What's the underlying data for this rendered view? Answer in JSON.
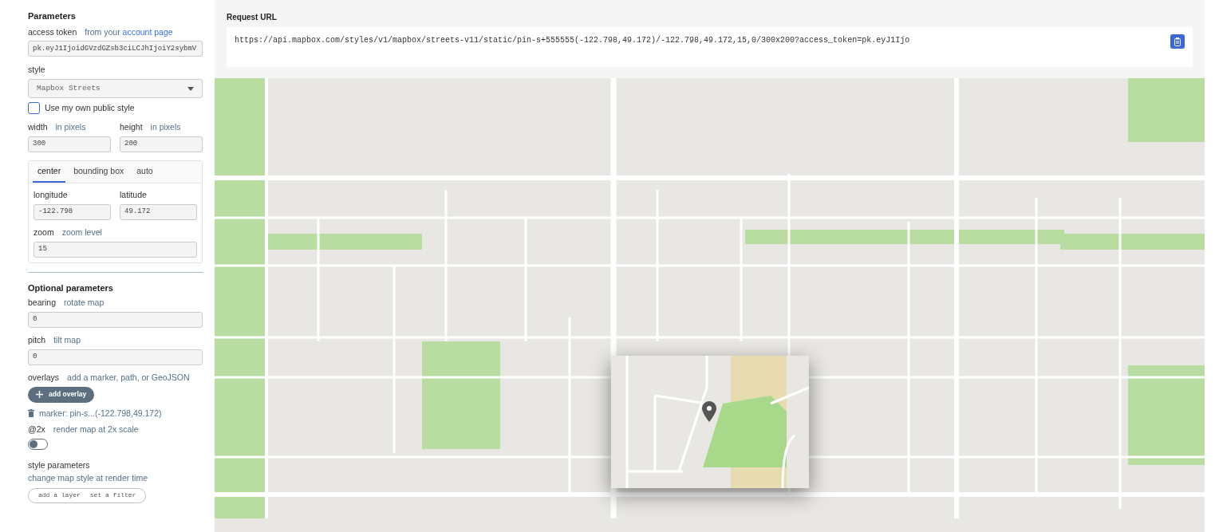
{
  "parameters": {
    "title": "Parameters",
    "access_token": {
      "label": "access token",
      "hint": "from your",
      "link": "account page",
      "value": "pk.eyJ1IjoidGVzdGZsb3ciLCJhIjoiY2sybmV"
    },
    "style": {
      "label": "style",
      "value": "Mapbox Streets"
    },
    "own_style": {
      "label": "Use my own public style",
      "checked": false
    },
    "size": [
      {
        "label": "width",
        "hint": "in pixels",
        "value": "300"
      },
      {
        "label": "height",
        "hint": "in pixels",
        "value": "200"
      }
    ],
    "tabs": [
      {
        "label": "center",
        "selected": true
      },
      {
        "label": "bounding box",
        "selected": false
      },
      {
        "label": "auto",
        "selected": false
      }
    ],
    "center": [
      {
        "label": "longitude",
        "value": "-122.798"
      },
      {
        "label": "latitude",
        "value": "49.172"
      }
    ],
    "zoom": {
      "label": "zoom",
      "hint": "zoom level",
      "value": "15"
    }
  },
  "optional": {
    "title": "Optional parameters",
    "fields": [
      {
        "label": "bearing",
        "hint": "rotate map",
        "value": "0"
      },
      {
        "label": "pitch",
        "hint": "tilt map",
        "value": "0"
      }
    ],
    "overlays": {
      "label": "overlays",
      "hint": "add a marker, path, or GeoJSON",
      "button": "add overlay",
      "items": [
        "marker: pin-s...(-122.798,49.172)"
      ]
    },
    "retina": {
      "label": "@2x",
      "hint": "render map at 2x scale",
      "on": false
    },
    "style_parameters": {
      "label": "style parameters",
      "hint": "change map style at render time",
      "buttons": [
        "add a layer",
        "set a filter"
      ]
    }
  },
  "request": {
    "label": "Request URL",
    "url": "https://api.mapbox.com/styles/v1/mapbox/streets-v11/static/pin-s+555555(-122.798,49.172)/-122.798,49.172,15,0/300x200?access_token=pk.eyJ1Ijo"
  }
}
